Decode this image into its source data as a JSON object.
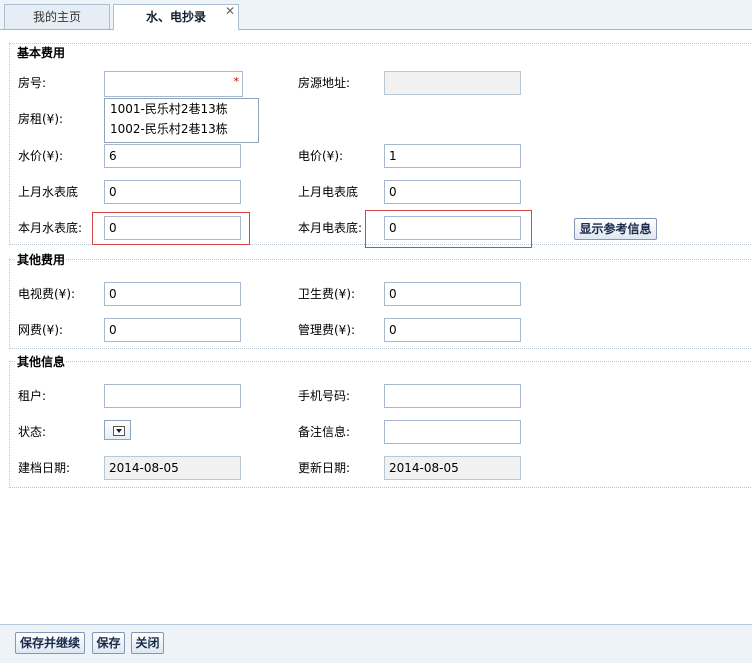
{
  "tabs": [
    {
      "label": "我的主页"
    },
    {
      "label": "水、电抄录",
      "close": "✕"
    }
  ],
  "groups": {
    "basic": "基本费用",
    "other_fees": "其他费用",
    "other_info": "其他信息"
  },
  "basic": {
    "room_no_label": "房号:",
    "room_no_value": "",
    "required_mark": "*",
    "address_label": "房源地址:",
    "address_value": "",
    "rent_label": "房租(¥):",
    "water_price_label": "水价(¥):",
    "water_price_value": "6",
    "elec_price_label": "电价(¥):",
    "elec_price_value": "1",
    "last_water_label": "上月水表底",
    "last_water_value": "0",
    "last_elec_label": "上月电表底",
    "last_elec_value": "0",
    "cur_water_label": "本月水表底:",
    "cur_water_value": "0",
    "cur_elec_label": "本月电表底:",
    "cur_elec_value": "0",
    "show_ref_button": "显示参考信息"
  },
  "dropdown": {
    "items": [
      "1001-民乐村2巷13栋",
      "1002-民乐村2巷13栋"
    ]
  },
  "other_fees": {
    "tv_label": "电视费(¥):",
    "tv_value": "0",
    "sanitation_label": "卫生费(¥):",
    "sanitation_value": "0",
    "net_label": "网费(¥):",
    "net_value": "0",
    "mgmt_label": "管理费(¥):",
    "mgmt_value": "0"
  },
  "other_info": {
    "tenant_label": "租户:",
    "tenant_value": "",
    "phone_label": "手机号码:",
    "phone_value": "",
    "status_label": "状态:",
    "note_label": "备注信息:",
    "note_value": "",
    "created_label": "建档日期:",
    "created_value": "2014-08-05",
    "updated_label": "更新日期:",
    "updated_value": "2014-08-05"
  },
  "footer": {
    "save_continue": "保存并继续",
    "save": "保存",
    "close": "关闭"
  }
}
